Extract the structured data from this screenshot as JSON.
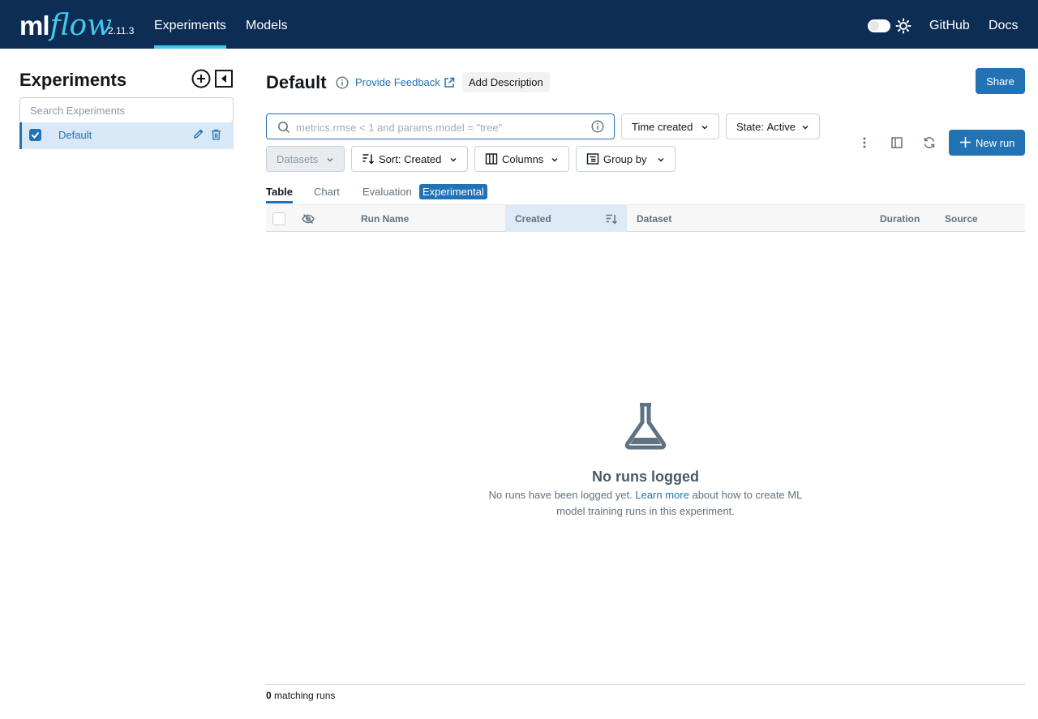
{
  "app": {
    "logo_ml": "ml",
    "logo_flow": "flow",
    "version": "2.11.3",
    "nav": {
      "experiments": "Experiments",
      "models": "Models",
      "github": "GitHub",
      "docs": "Docs"
    },
    "theme_dark": false
  },
  "sidebar": {
    "title": "Experiments",
    "search_placeholder": "Search Experiments",
    "experiments": [
      {
        "name": "Default",
        "checked": true
      }
    ]
  },
  "header": {
    "title": "Default",
    "feedback_label": "Provide Feedback",
    "add_description_label": "Add Description",
    "share_label": "Share"
  },
  "controls": {
    "search_placeholder": "metrics.rmse < 1 and params.model = \"tree\"",
    "time_created_label": "Time created",
    "state_label": "State:",
    "state_value": "Active",
    "datasets_label": "Datasets",
    "sort_label": "Sort: Created",
    "columns_label": "Columns",
    "group_by_label": "Group by",
    "new_run_label": "New run"
  },
  "tabs": {
    "table": "Table",
    "chart": "Chart",
    "evaluation": "Evaluation",
    "experimental_badge": "Experimental"
  },
  "table": {
    "columns": [
      "Run Name",
      "Created",
      "Dataset",
      "Duration",
      "Source"
    ],
    "rows": []
  },
  "empty_state": {
    "title": "No runs logged",
    "desc_before": "No runs have been logged yet.",
    "learn_more": "Learn more",
    "desc_after": "about how to create ML model training runs in this experiment."
  },
  "footer": {
    "count": "0",
    "label": "matching runs"
  },
  "colors": {
    "topbar": "#0e2d54",
    "accent": "#2272b4",
    "logo_flow": "#43c9ed"
  }
}
